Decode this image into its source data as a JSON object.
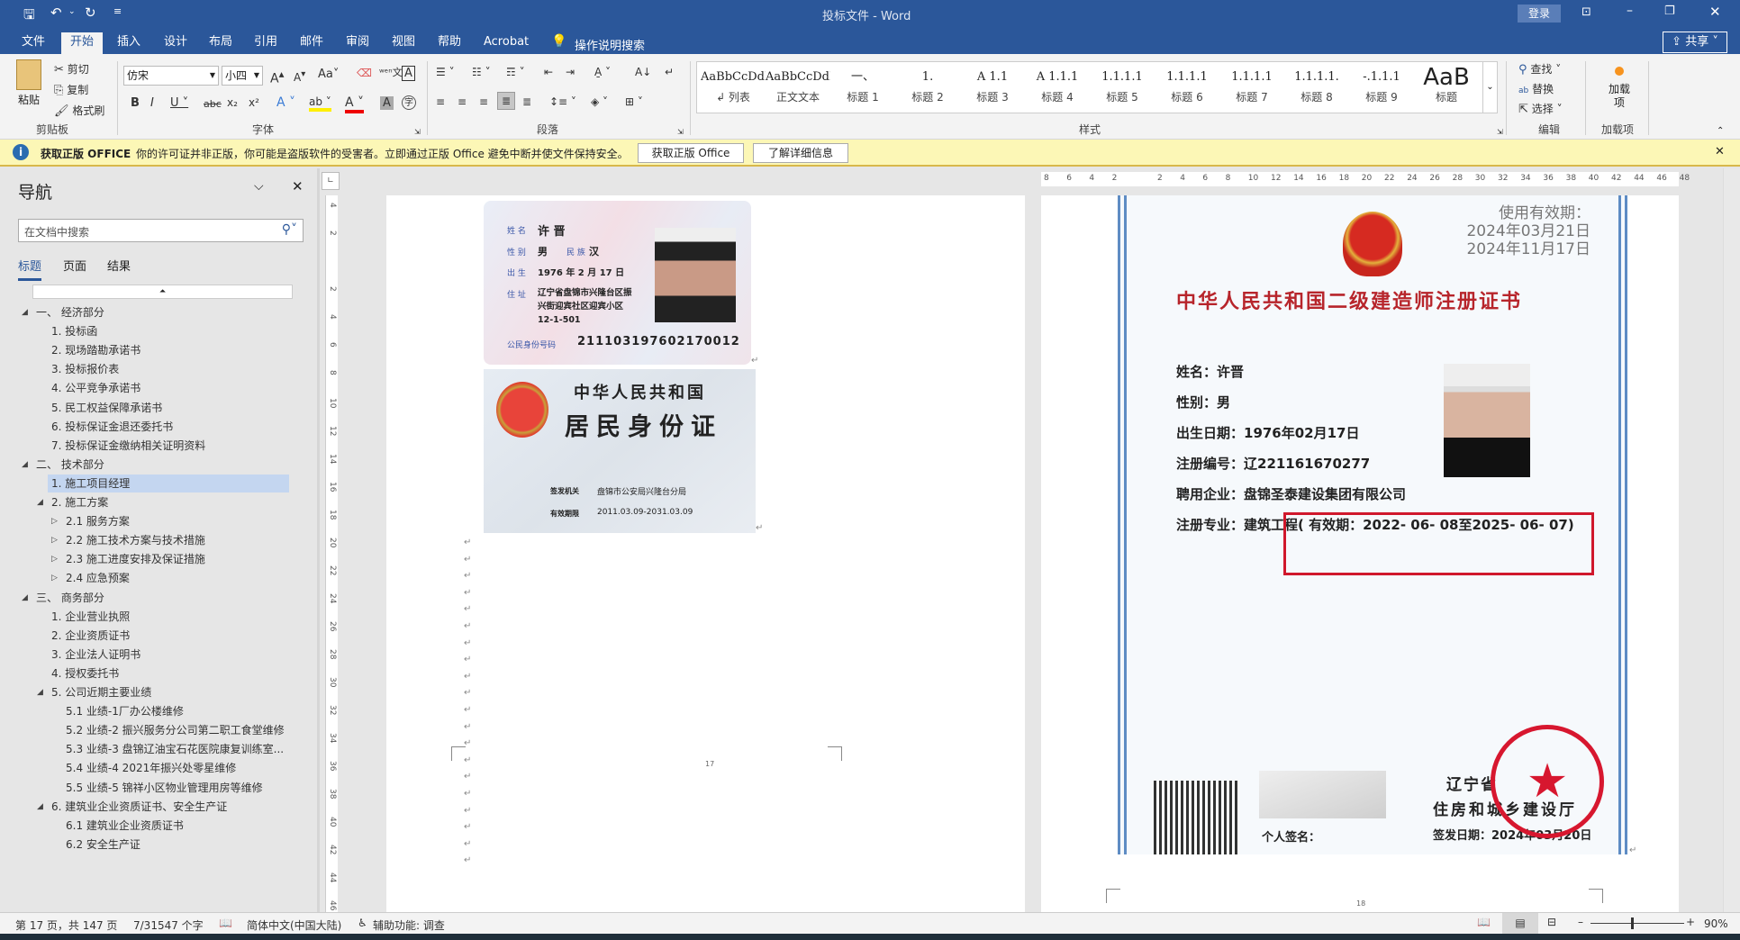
{
  "window": {
    "title": "投标文件 - Word",
    "login": "登录",
    "share": "共享"
  },
  "tabs": [
    "文件",
    "开始",
    "插入",
    "设计",
    "布局",
    "引用",
    "邮件",
    "审阅",
    "视图",
    "帮助",
    "Acrobat"
  ],
  "tell_me": "操作说明搜索",
  "ribbon": {
    "clipboard": {
      "paste": "粘贴",
      "cut": "剪切",
      "copy": "复制",
      "format_painter": "格式刷",
      "label": "剪贴板"
    },
    "font": {
      "name": "仿宋",
      "size": "小四",
      "label": "字体",
      "case": "Aa"
    },
    "paragraph": {
      "label": "段落"
    },
    "styles": {
      "label": "样式",
      "items": [
        {
          "preview": "AaBbCcDdI",
          "name": "↲ 列表"
        },
        {
          "preview": "AaBbCcDdI",
          "name": "正文文本"
        },
        {
          "preview": "一、",
          "name": "标题 1"
        },
        {
          "preview": "1.",
          "name": "标题 2"
        },
        {
          "preview": "A 1.1",
          "name": "标题 3"
        },
        {
          "preview": "A 1.1.1",
          "name": "标题 4"
        },
        {
          "preview": "1.1.1.1",
          "name": "标题 5"
        },
        {
          "preview": "1.1.1.1",
          "name": "标题 6"
        },
        {
          "preview": "1.1.1.1",
          "name": "标题 7"
        },
        {
          "preview": "1.1.1.1.",
          "name": "标题 8"
        },
        {
          "preview": "-.1.1.1",
          "name": "标题 9"
        },
        {
          "preview": "AaB",
          "name": "标题"
        }
      ]
    },
    "editing": {
      "find": "查找",
      "replace": "替换",
      "select": "选择",
      "label": "编辑"
    },
    "addins": {
      "button": "加载项",
      "label": "加载项"
    }
  },
  "infobar": {
    "title": "获取正版 OFFICE",
    "message": "你的许可证并非正版，你可能是盗版软件的受害者。立即通过正版 Office 避免中断并使文件保持安全。",
    "btn_get": "获取正版 Office",
    "btn_learn": "了解详细信息"
  },
  "nav": {
    "title": "导航",
    "search_placeholder": "在文档中搜索",
    "tabs": [
      "标题",
      "页面",
      "结果"
    ],
    "items": [
      {
        "t": "一、  经济部分",
        "lvl": 0,
        "tri": "open"
      },
      {
        "t": "1. 投标函",
        "lvl": 1
      },
      {
        "t": "2. 现场踏勘承诺书",
        "lvl": 1
      },
      {
        "t": "3. 投标报价表",
        "lvl": 1
      },
      {
        "t": "4. 公平竞争承诺书",
        "lvl": 1
      },
      {
        "t": "5. 民工权益保障承诺书",
        "lvl": 1
      },
      {
        "t": "6. 投标保证金退还委托书",
        "lvl": 1
      },
      {
        "t": "7. 投标保证金缴纳相关证明资料",
        "lvl": 1
      },
      {
        "t": "二、  技术部分",
        "lvl": 0,
        "tri": "open"
      },
      {
        "t": "1. 施工项目经理",
        "lvl": 1,
        "sel": true
      },
      {
        "t": "2. 施工方案",
        "lvl": 1,
        "tri": "open"
      },
      {
        "t": "2.1 服务方案",
        "lvl": 2,
        "tri": "closed"
      },
      {
        "t": "2.2 施工技术方案与技术措施",
        "lvl": 2,
        "tri": "closed"
      },
      {
        "t": "2.3 施工进度安排及保证措施",
        "lvl": 2,
        "tri": "closed"
      },
      {
        "t": "2.4 应急预案",
        "lvl": 2,
        "tri": "closed"
      },
      {
        "t": "三、  商务部分",
        "lvl": 0,
        "tri": "open"
      },
      {
        "t": "1. 企业营业执照",
        "lvl": 1
      },
      {
        "t": "2. 企业资质证书",
        "lvl": 1
      },
      {
        "t": "3. 企业法人证明书",
        "lvl": 1
      },
      {
        "t": "4. 授权委托书",
        "lvl": 1
      },
      {
        "t": "5. 公司近期主要业绩",
        "lvl": 1,
        "tri": "open"
      },
      {
        "t": "5.1 业绩-1厂办公楼维修",
        "lvl": 2
      },
      {
        "t": "5.2 业绩-2 振兴服务分公司第二职工食堂维修",
        "lvl": 2
      },
      {
        "t": "5.3 业绩-3  盘锦辽油宝石花医院康复训练室...",
        "lvl": 2
      },
      {
        "t": "5.4 业绩-4  2021年振兴处零星维修",
        "lvl": 2
      },
      {
        "t": "5.5 业绩-5 锦祥小区物业管理用房等维修",
        "lvl": 2
      },
      {
        "t": "6. 建筑业企业资质证书、安全生产证",
        "lvl": 1,
        "tri": "open"
      },
      {
        "t": "6.1 建筑业企业资质证书",
        "lvl": 2
      },
      {
        "t": "6.2 安全生产证",
        "lvl": 2
      }
    ]
  },
  "id_front": {
    "name_label": "姓 名",
    "name": "许 晋",
    "sex_label": "性 别",
    "sex": "男",
    "ethnic_label": "民 族",
    "ethnic": "汉",
    "birth_label": "出 生",
    "birth": "1976 年 2 月 17 日",
    "addr_label": "住 址",
    "addr1": "辽宁省盘锦市兴隆台区振",
    "addr2": "兴街迎宾社区迎宾小区",
    "addr3": "12-1-501",
    "id_label": "公民身份号码",
    "id_no": "211103197602170012"
  },
  "id_back": {
    "line1": "中华人民共和国",
    "line2": "居民身份证",
    "issuer_label": "签发机关",
    "issuer": "盘锦市公安局兴隆台分局",
    "valid_label": "有效期限",
    "valid": "2011.03.09-2031.03.09"
  },
  "cert": {
    "validity_label": "使用有效期：",
    "valid_from": "2024年03月21日",
    "valid_to": "2024年11月17日",
    "title": "中华人民共和国二级建造师注册证书",
    "fields": [
      "姓名：许晋",
      "性别：男",
      "出生日期：1976年02月17日",
      "注册编号：辽221161670277",
      "聘用企业：盘锦圣泰建设集团有限公司",
      "注册专业：建筑工程( 有效期：2022- 06- 08至2025- 06- 07)"
    ],
    "signature_label": "个人签名：",
    "issuer1": "辽宁省",
    "issuer2": "住房和城乡建设厅",
    "issue_date": "签发日期：2024年03月20日",
    "seal_text": "辽宁省住房和城乡建设厅"
  },
  "pages": {
    "left_num": "17",
    "right_num": "18"
  },
  "ruler_h": [
    "8",
    "6",
    "4",
    "2",
    "",
    "2",
    "4",
    "6",
    "8",
    "10",
    "12",
    "14",
    "16",
    "18",
    "20",
    "22",
    "24",
    "26",
    "28",
    "30",
    "32",
    "34",
    "36",
    "38",
    "40",
    "42",
    "44",
    "46",
    "48"
  ],
  "ruler_v": [
    "4",
    "2",
    "",
    "2",
    "4",
    "6",
    "8",
    "10",
    "12",
    "14",
    "16",
    "18",
    "20",
    "22",
    "24",
    "26",
    "28",
    "30",
    "32",
    "34",
    "36",
    "38",
    "40",
    "42",
    "44",
    "46"
  ],
  "status": {
    "page": "第 17 页，共 147 页",
    "words": "7/31547 个字",
    "lang": "简体中文(中国大陆)",
    "access": "辅助功能: 调查",
    "zoom": "90%"
  },
  "colors": {
    "brand": "#2b579a",
    "seal": "#d7172f",
    "highlight_box": "#d0182c"
  }
}
